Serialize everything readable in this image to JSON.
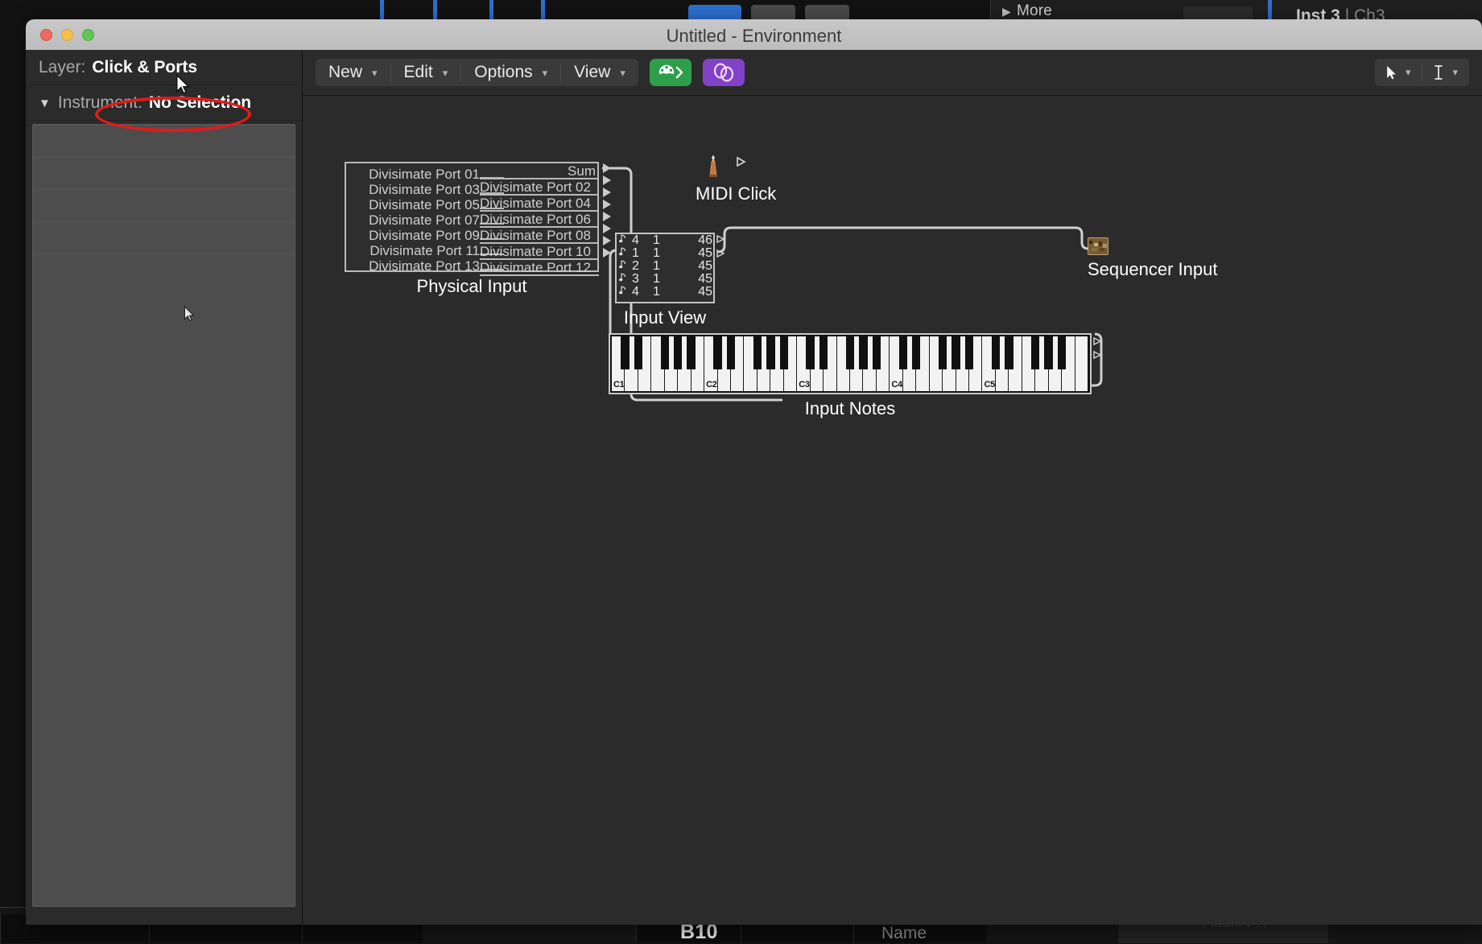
{
  "background": {
    "more_label": "More",
    "more_icon": "triangle-right-icon",
    "inst_name": "Inst 3",
    "inst_channel": "| Ch3",
    "bottom_cell_value": "B10",
    "bottom_name_placeholder": "Name",
    "bottom_audiofx_label": "Audio FX"
  },
  "window": {
    "title": "Untitled - Environment",
    "traffic_lights": [
      "close-button",
      "minimize-button",
      "zoom-button"
    ],
    "colors": {
      "close": "#ec6a5e",
      "minimize": "#f5bf4f",
      "zoom": "#61c554",
      "titlebar": "#c8c8c8",
      "canvas": "#2b2b2b",
      "annotation": "#e01b1b",
      "midi_button": "#2e9e4b",
      "link_button": "#8242c8"
    }
  },
  "inspector": {
    "layer_label": "Layer:",
    "layer_value": "Click & Ports",
    "instrument_label": "Instrument:",
    "instrument_value": "No Selection",
    "disclosure_icon": "triangle-down-icon"
  },
  "toolbar": {
    "menus": [
      {
        "label": "New",
        "icon": "chevron-down-icon"
      },
      {
        "label": "Edit",
        "icon": "chevron-down-icon"
      },
      {
        "label": "Options",
        "icon": "chevron-down-icon"
      },
      {
        "label": "View",
        "icon": "chevron-down-icon"
      }
    ],
    "midi_button_icon": "midi-din-connector-icon",
    "link_button_icon": "link-chain-icon",
    "tools": [
      {
        "icon": "pointer-arrow-icon",
        "chevron": "chevron-down-icon"
      },
      {
        "icon": "text-ibeam-icon",
        "chevron": "chevron-down-icon"
      }
    ]
  },
  "canvas": {
    "objects": [
      {
        "name": "Physical Input",
        "caption": "Physical Input",
        "left_ports": [
          "Divisimate Port 01",
          "Divisimate Port 03",
          "Divisimate Port 05",
          "Divisimate Port 07",
          "Divisimate Port 09",
          "Divisimate Port 11",
          "Divisimate Port 13"
        ],
        "right_ports": [
          "Sum",
          "Divisimate Port 02",
          "Divisimate Port 04",
          "Divisimate Port 06",
          "Divisimate Port 08",
          "Divisimate Port 10",
          "Divisimate Port 12"
        ],
        "port_count": 13
      },
      {
        "name": "MIDI Click",
        "caption": "MIDI Click",
        "icon": "metronome-icon",
        "output_icon": "output-triangle-icon"
      },
      {
        "name": "Input View",
        "caption": "Input View",
        "columns": [
          "note-icon",
          "channel",
          "value1",
          "value2"
        ],
        "rows": [
          {
            "icon": "note-icon",
            "c1": "4",
            "c2": "1",
            "c3": "46"
          },
          {
            "icon": "note-icon",
            "c1": "1",
            "c2": "1",
            "c3": "45"
          },
          {
            "icon": "note-icon",
            "c1": "2",
            "c2": "1",
            "c3": "45"
          },
          {
            "icon": "note-icon",
            "c1": "3",
            "c2": "1",
            "c3": "45"
          },
          {
            "icon": "note-icon",
            "c1": "4",
            "c2": "1",
            "c3": "45"
          }
        ]
      },
      {
        "name": "Sequencer Input",
        "caption": "Sequencer Input",
        "icon": "sequencer-thumbnail-icon"
      },
      {
        "name": "Input Notes",
        "caption": "Input Notes",
        "octave_labels": [
          "C1",
          "C2",
          "C3",
          "C4",
          "C5"
        ],
        "octaves": 5
      }
    ]
  }
}
